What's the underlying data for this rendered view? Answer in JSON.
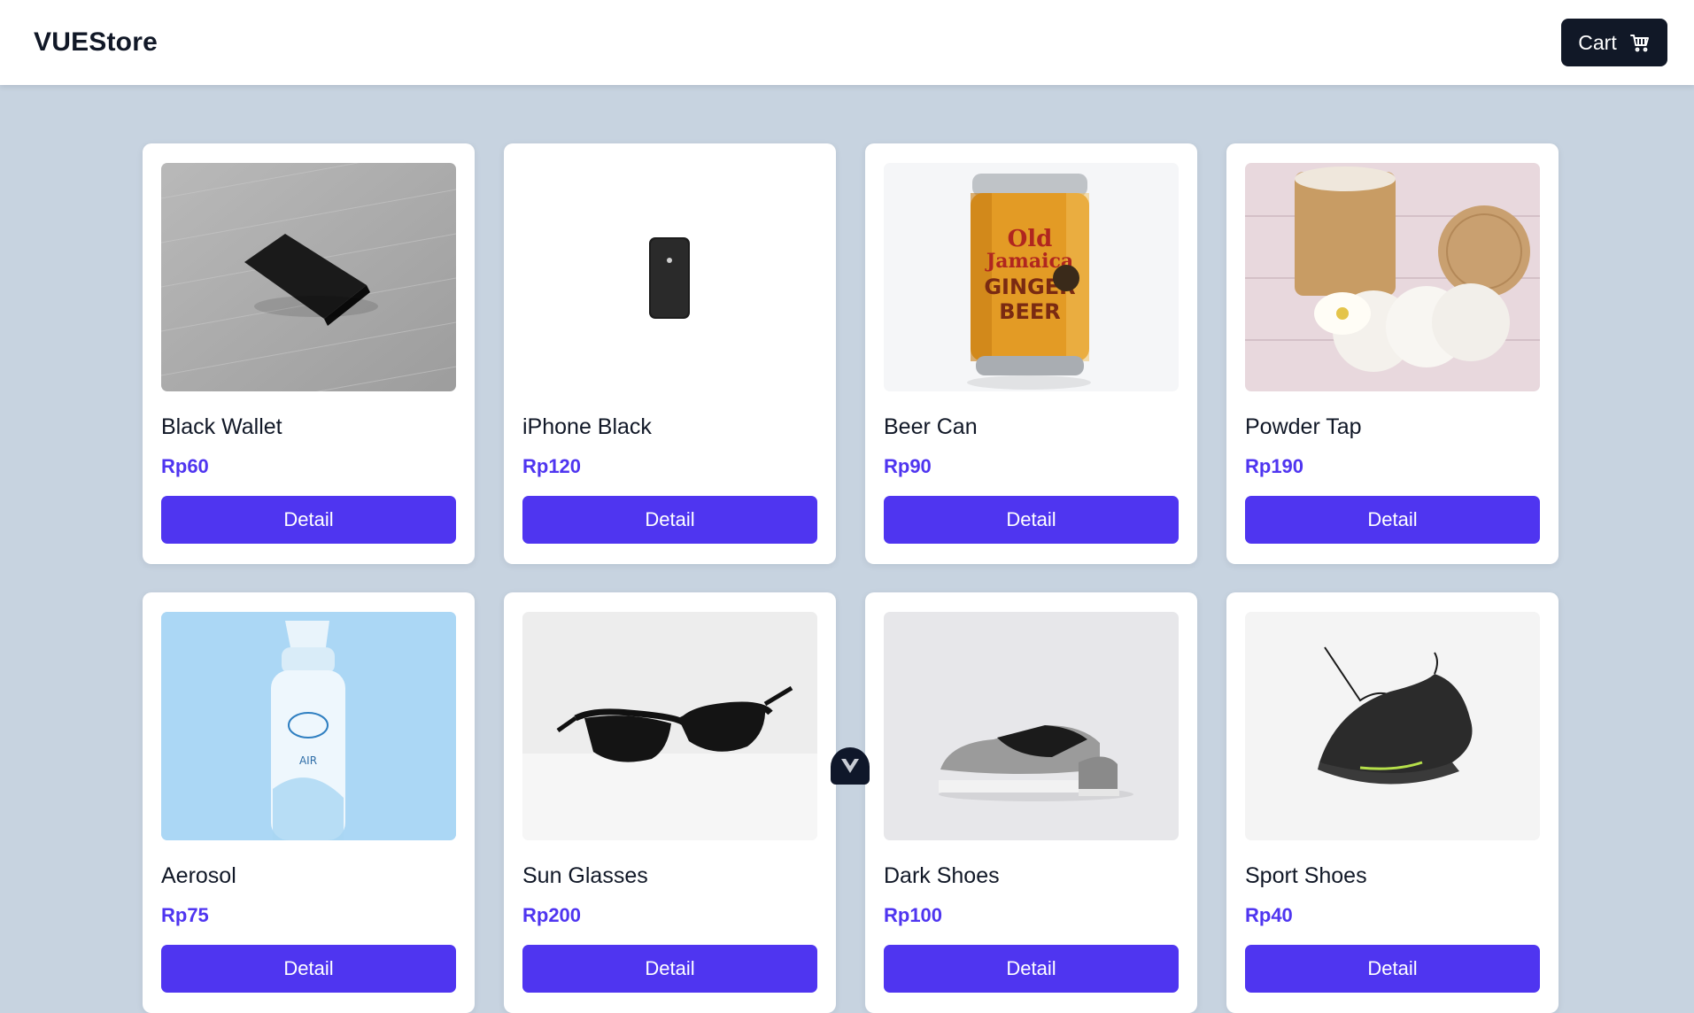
{
  "header": {
    "brand": "VUEStore",
    "cart_label": "Cart"
  },
  "products": [
    {
      "name": "Black Wallet",
      "price": "Rp60",
      "action": "Detail",
      "image": "wallet-photo"
    },
    {
      "name": "iPhone Black",
      "price": "Rp120",
      "action": "Detail",
      "image": "iphone-photo"
    },
    {
      "name": "Beer Can",
      "price": "Rp90",
      "action": "Detail",
      "image": "beer-can-photo"
    },
    {
      "name": "Powder Tap",
      "price": "Rp190",
      "action": "Detail",
      "image": "powder-tap-photo"
    },
    {
      "name": "Aerosol",
      "price": "Rp75",
      "action": "Detail",
      "image": "aerosol-photo"
    },
    {
      "name": "Sun Glasses",
      "price": "Rp200",
      "action": "Detail",
      "image": "sunglasses-photo"
    },
    {
      "name": "Dark Shoes",
      "price": "Rp100",
      "action": "Detail",
      "image": "dark-shoes-photo"
    },
    {
      "name": "Sport Shoes",
      "price": "Rp40",
      "action": "Detail",
      "image": "sport-shoes-photo"
    }
  ],
  "colors": {
    "background": "#c7d3e0",
    "accent": "#4f35f0",
    "dark": "#111827"
  },
  "icons": {
    "cart": "cart-icon",
    "devtools": "vue-devtools-icon"
  }
}
